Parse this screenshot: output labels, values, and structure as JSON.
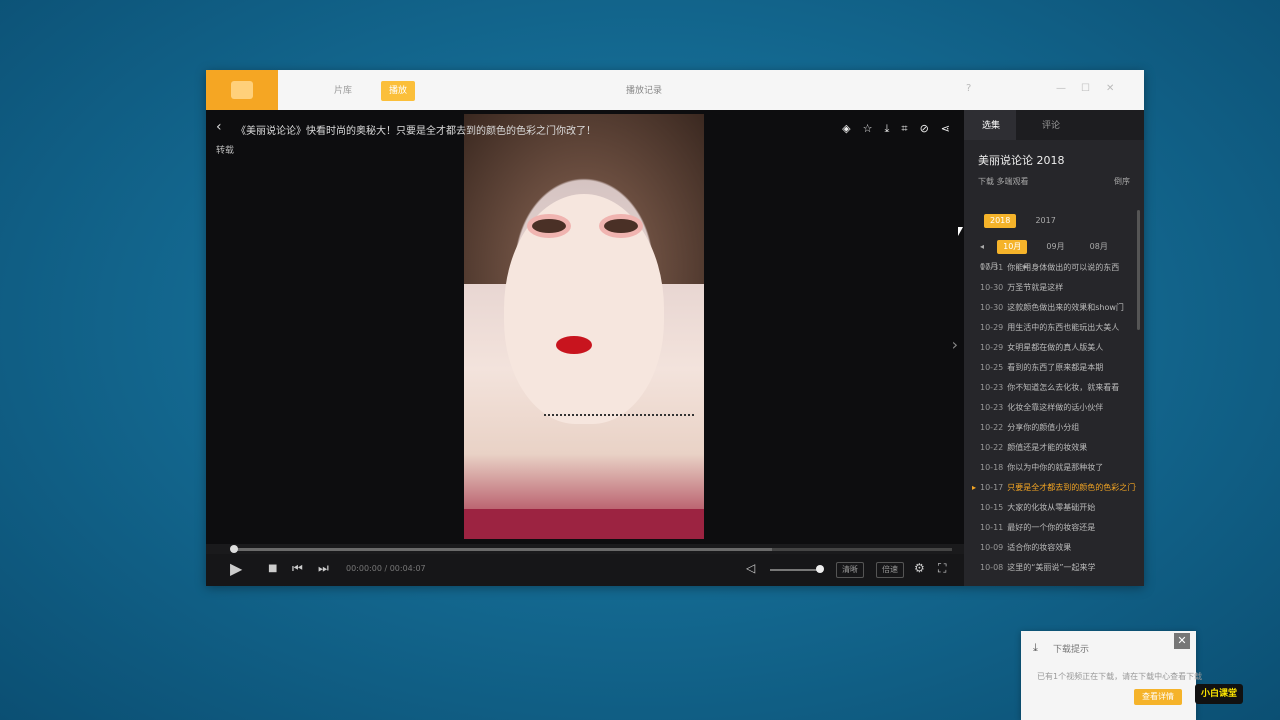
{
  "titlebar": {
    "tabs": [
      "片库",
      "播放"
    ],
    "title": "播放记录",
    "controls": [
      "?",
      "—",
      "☐",
      "✕"
    ]
  },
  "player": {
    "title": "《美丽说论论》快看时尚的奥秘大！只要是全才都去到的颜色的色彩之门你改了！",
    "subtitle": "转载",
    "time": "00:00:00 / 00:04:07",
    "buttons": [
      "清晰",
      "倍速"
    ],
    "progress": 0.75,
    "volume": 0.85
  },
  "sidebar": {
    "tabs": [
      "选集",
      "评论"
    ],
    "title": "美丽说论论 2018",
    "actions": "下载   多端观看",
    "sort": "倒序",
    "years": [
      "2018",
      "2017"
    ],
    "months": [
      "10月",
      "09月",
      "08月",
      "07月"
    ],
    "episodes": [
      {
        "date": "10-31",
        "title": "你能用身体做出的可以说的东西",
        "current": false
      },
      {
        "date": "10-30",
        "title": "万圣节就是这样",
        "current": false
      },
      {
        "date": "10-30",
        "title": "这款颜色做出来的效果和show门",
        "current": false
      },
      {
        "date": "10-29",
        "title": "用生活中的东西也能玩出大美人",
        "current": false
      },
      {
        "date": "10-29",
        "title": "女明星都在做的真人版美人",
        "current": false
      },
      {
        "date": "10-25",
        "title": "看到的东西了原来都是本期",
        "current": false
      },
      {
        "date": "10-23",
        "title": "你不知道怎么去化妆，就来看看",
        "current": false
      },
      {
        "date": "10-23",
        "title": "化妆全靠这样做的话小伙伴",
        "current": false
      },
      {
        "date": "10-22",
        "title": "分享你的颜值小分组",
        "current": false
      },
      {
        "date": "10-22",
        "title": "颜值还是才能的妆效果",
        "current": false
      },
      {
        "date": "10-18",
        "title": "你以为中你的就是那种妆了",
        "current": false
      },
      {
        "date": "10-17",
        "title": "只要是全才都去到的颜色的色彩之门你改了",
        "current": true
      },
      {
        "date": "10-15",
        "title": "大家的化妆从零基础开始",
        "current": false
      },
      {
        "date": "10-11",
        "title": "最好的一个你的妆容还是",
        "current": false
      },
      {
        "date": "10-09",
        "title": "适合你的妆容效果",
        "current": false
      },
      {
        "date": "10-08",
        "title": "这里的“美丽说”一起来学",
        "current": false
      }
    ]
  },
  "toast": {
    "title": "下载提示",
    "body": "已有1个视频正在下载，请在下载中心查看下载",
    "button": "查看详情"
  },
  "badge": "小白课堂",
  "colors": {
    "accent": "#f5a623",
    "background": "#146a92"
  }
}
